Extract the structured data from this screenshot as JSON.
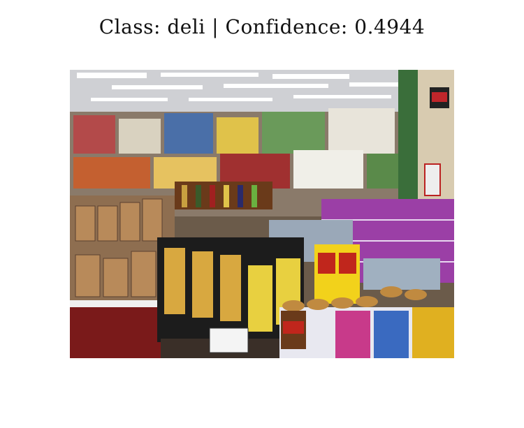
{
  "classification": {
    "label_prefix": "Class:",
    "class_name": "deli",
    "separator": "|",
    "confidence_prefix": "Confidence:",
    "confidence": "0.4944",
    "title_text": "Class: deli | Confidence: 0.4944"
  },
  "photo": {
    "subject": "grocery store interior with stacked products",
    "colors": {
      "ceiling": "#d9d9dc",
      "light": "#ffffff",
      "floor_shadow": "#3a2f28",
      "shelf": "#c8b8a0",
      "purple_boxes": "#9b3fa6",
      "yellow_boxes": "#f2d21b",
      "black_boxes": "#1a1a1a",
      "jars_amber": "#b07a4a",
      "green_wall": "#3a6e3a"
    }
  }
}
